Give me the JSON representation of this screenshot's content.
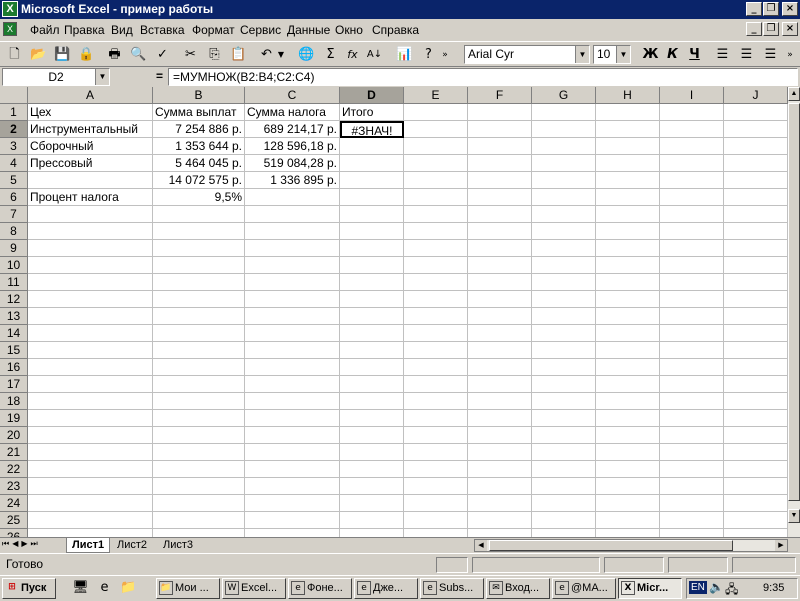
{
  "window": {
    "title": "Microsoft Excel - пример работы",
    "app_icon": "excel-icon"
  },
  "menus": [
    "Файл",
    "Правка",
    "Вид",
    "Вставка",
    "Формат",
    "Сервис",
    "Данные",
    "Окно",
    "Справка"
  ],
  "toolbar": {
    "font": "Arial Cyr",
    "size": "10",
    "bold": "Ж",
    "italic": "К",
    "underline": "Ч",
    "sum": "Σ",
    "fx": "fx"
  },
  "formula_bar": {
    "name_box": "D2",
    "eq": "=",
    "formula": "=МУМНОЖ(B2:B4;C2:C4)"
  },
  "grid": {
    "columns": [
      "A",
      "B",
      "C",
      "D",
      "E",
      "F",
      "G",
      "H",
      "I",
      "J"
    ],
    "rows": [
      "1",
      "2",
      "3",
      "4",
      "5",
      "6",
      "7",
      "8",
      "9",
      "10",
      "11",
      "12",
      "13",
      "14",
      "15",
      "16",
      "17",
      "18",
      "19",
      "20",
      "21",
      "22",
      "23",
      "24",
      "25",
      "26"
    ],
    "active_cell": "D2",
    "cells": [
      {
        "ref": "A1",
        "value": "Цех"
      },
      {
        "ref": "B1",
        "value": "Сумма выплат"
      },
      {
        "ref": "C1",
        "value": "Сумма налога"
      },
      {
        "ref": "D1",
        "value": "Итого"
      },
      {
        "ref": "A2",
        "value": "Инструментальный"
      },
      {
        "ref": "B2",
        "value": "7 254 886 р.",
        "align": "right"
      },
      {
        "ref": "C2",
        "value": "689 214,17 р.",
        "align": "right"
      },
      {
        "ref": "D2",
        "value": "#ЗНАЧ!",
        "align": "center"
      },
      {
        "ref": "A3",
        "value": "Сборочный"
      },
      {
        "ref": "B3",
        "value": "1 353 644 р.",
        "align": "right"
      },
      {
        "ref": "C3",
        "value": "128 596,18 р.",
        "align": "right"
      },
      {
        "ref": "A4",
        "value": "Прессовый"
      },
      {
        "ref": "B4",
        "value": "5 464 045 р.",
        "align": "right"
      },
      {
        "ref": "C4",
        "value": "519 084,28 р.",
        "align": "right"
      },
      {
        "ref": "B5",
        "value": "14 072 575 р.",
        "align": "right"
      },
      {
        "ref": "C5",
        "value": "1 336 895 р.",
        "align": "right"
      },
      {
        "ref": "A6",
        "value": "Процент налога"
      },
      {
        "ref": "B6",
        "value": "9,5%",
        "align": "right"
      }
    ]
  },
  "sheets": {
    "tabs": [
      "Лист1",
      "Лист2",
      "Лист3"
    ],
    "active": "Лист1"
  },
  "status": {
    "text": "Готово"
  },
  "taskbar": {
    "start": "Пуск",
    "items": [
      {
        "label": "Мои ...",
        "icon": "folder-icon"
      },
      {
        "label": "Excel...",
        "icon": "word-icon"
      },
      {
        "label": "Фоне...",
        "icon": "browser-icon"
      },
      {
        "label": "Дже...",
        "icon": "browser-icon"
      },
      {
        "label": "Subs...",
        "icon": "browser-icon"
      },
      {
        "label": "Вход...",
        "icon": "mail-icon"
      },
      {
        "label": "@MA...",
        "icon": "browser-icon"
      },
      {
        "label": "Micr...",
        "icon": "excel-icon",
        "active": true
      }
    ],
    "lang": "EN",
    "clock": "9:35"
  }
}
